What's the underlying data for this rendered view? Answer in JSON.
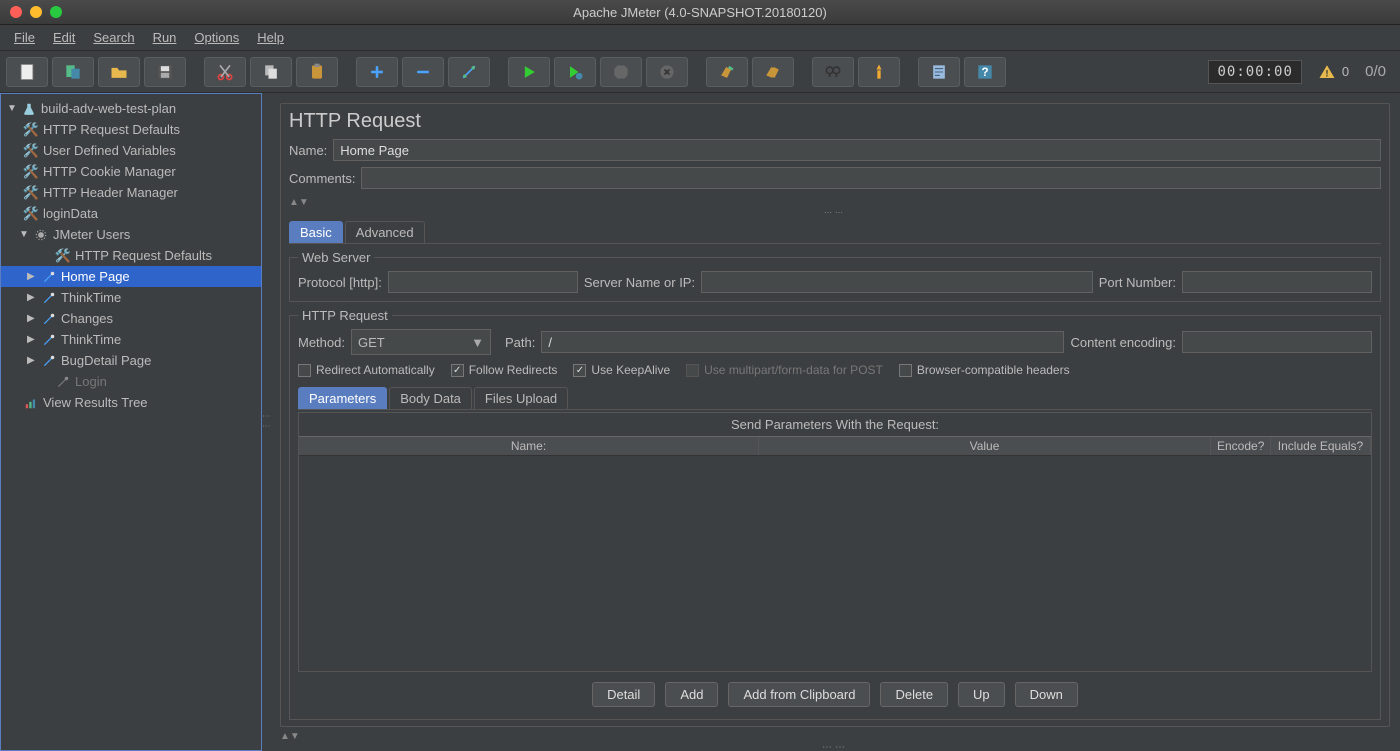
{
  "window": {
    "title": "Apache JMeter (4.0-SNAPSHOT.20180120)"
  },
  "menu": {
    "file": "File",
    "edit": "Edit",
    "search": "Search",
    "run": "Run",
    "options": "Options",
    "help": "Help"
  },
  "status": {
    "timer": "00:00:00",
    "warnings": "0",
    "counts": "0/0"
  },
  "tree": {
    "root": "build-adv-web-test-plan",
    "items": [
      "HTTP Request Defaults",
      "User Defined Variables",
      "HTTP Cookie Manager",
      "HTTP Header Manager",
      "loginData"
    ],
    "threadgroup": "JMeter Users",
    "tg_items": {
      "defaults": "HTTP Request Defaults",
      "home": "Home Page",
      "think1": "ThinkTime",
      "changes": "Changes",
      "think2": "ThinkTime",
      "bugdetail": "BugDetail Page",
      "login": "Login"
    },
    "results": "View Results Tree"
  },
  "main": {
    "heading": "HTTP Request",
    "name_label": "Name:",
    "name_value": "Home Page",
    "comments_label": "Comments:",
    "comments_value": "",
    "tabs": {
      "basic": "Basic",
      "advanced": "Advanced"
    },
    "webserver": {
      "legend": "Web Server",
      "protocol_label": "Protocol [http]:",
      "protocol_value": "",
      "server_label": "Server Name or IP:",
      "server_value": "",
      "port_label": "Port Number:",
      "port_value": ""
    },
    "http": {
      "legend": "HTTP Request",
      "method_label": "Method:",
      "method_value": "GET",
      "path_label": "Path:",
      "path_value": "/",
      "enc_label": "Content encoding:",
      "enc_value": ""
    },
    "checks": {
      "redirect_auto": "Redirect Automatically",
      "follow": "Follow Redirects",
      "keepalive": "Use KeepAlive",
      "multipart": "Use multipart/form-data for POST",
      "browser_compat": "Browser-compatible headers"
    },
    "param_tabs": {
      "params": "Parameters",
      "body": "Body Data",
      "files": "Files Upload"
    },
    "params_title": "Send Parameters With the Request:",
    "cols": {
      "name": "Name:",
      "value": "Value",
      "encode": "Encode?",
      "include": "Include Equals?"
    },
    "buttons": {
      "detail": "Detail",
      "add": "Add",
      "addclip": "Add from Clipboard",
      "delete": "Delete",
      "up": "Up",
      "down": "Down"
    }
  }
}
